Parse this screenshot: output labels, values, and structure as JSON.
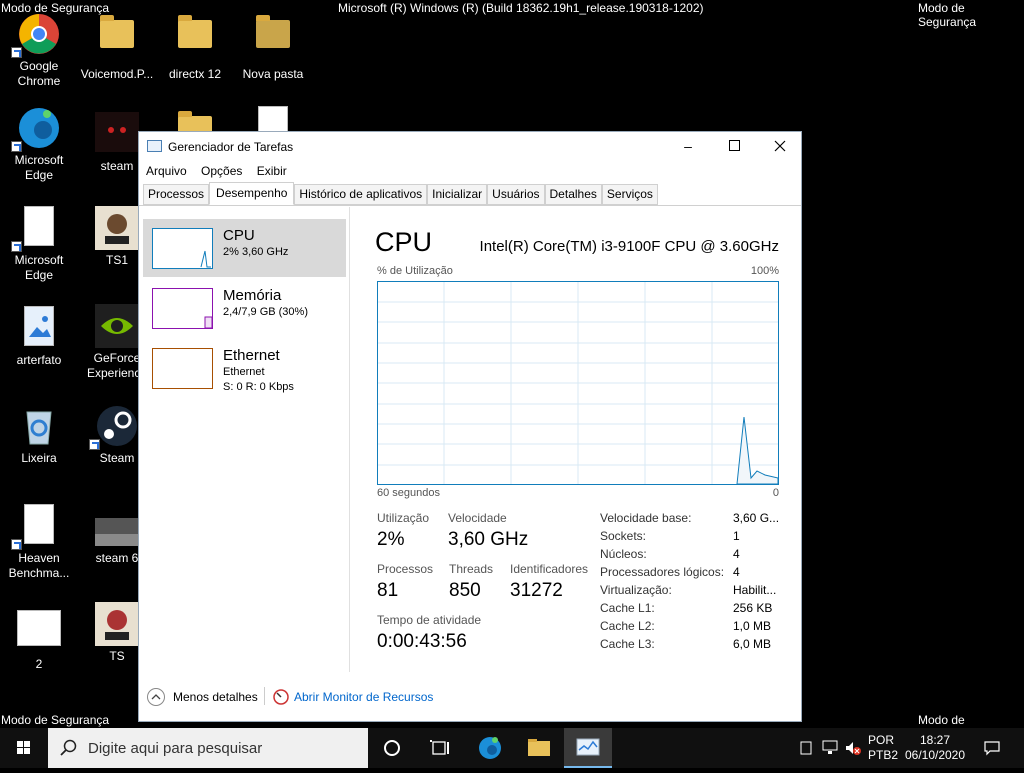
{
  "desktop": {
    "safe_mode": "Modo de Segurança",
    "build": "Microsoft (R) Windows (R) (Build 18362.19h1_release.190318-1202)",
    "icons": [
      {
        "label": "Google Chrome"
      },
      {
        "label": "Voicemod.P..."
      },
      {
        "label": "directx 12"
      },
      {
        "label": "Nova pasta"
      },
      {
        "label": "Microsoft Edge"
      },
      {
        "label": "steam"
      },
      {
        "label": "Microsoft Edge"
      },
      {
        "label": "TS1"
      },
      {
        "label": "arterfato"
      },
      {
        "label": "GeForce Experience"
      },
      {
        "label": "Lixeira"
      },
      {
        "label": "Steam"
      },
      {
        "label": "Heaven Benchma..."
      },
      {
        "label": "steam 6"
      },
      {
        "label": "2"
      },
      {
        "label": "TS"
      }
    ]
  },
  "window": {
    "title": "Gerenciador de Tarefas",
    "menu": [
      "Arquivo",
      "Opções",
      "Exibir"
    ],
    "tabs": [
      "Processos",
      "Desempenho",
      "Histórico de aplicativos",
      "Inicializar",
      "Usuários",
      "Detalhes",
      "Serviços"
    ],
    "active_tab": "Desempenho"
  },
  "resources": [
    {
      "name": "CPU",
      "line2": "2% 3,60 GHz",
      "line3": "",
      "color": "#117dbb"
    },
    {
      "name": "Memória",
      "line2": "2,4/7,9 GB (30%)",
      "line3": "",
      "color": "#8b12ae"
    },
    {
      "name": "Ethernet",
      "line2": "Ethernet",
      "line3": "S: 0 R: 0 Kbps",
      "color": "#a74f01"
    }
  ],
  "cpu": {
    "title": "CPU",
    "model": "Intel(R) Core(TM) i3-9100F CPU @ 3.60GHz",
    "graph_label": "% de Utilização",
    "graph_max": "100%",
    "graph_time": "60 segundos",
    "graph_min": "0",
    "utilizacao_label": "Utilização",
    "utilizacao": "2%",
    "velocidade_label": "Velocidade",
    "velocidade": "3,60 GHz",
    "processos_label": "Processos",
    "processos": "81",
    "threads_label": "Threads",
    "threads": "850",
    "ident_label": "Identificadores",
    "ident": "31272",
    "tempo_label": "Tempo de atividade",
    "tempo": "0:00:43:56",
    "details": [
      {
        "k": "Velocidade base:",
        "v": "3,60 G..."
      },
      {
        "k": "Sockets:",
        "v": "1"
      },
      {
        "k": "Núcleos:",
        "v": "4"
      },
      {
        "k": "Processadores lógicos:",
        "v": "4"
      },
      {
        "k": "Virtualização:",
        "v": "Habilit..."
      },
      {
        "k": "Cache L1:",
        "v": "256 KB"
      },
      {
        "k": "Cache L2:",
        "v": "1,0 MB"
      },
      {
        "k": "Cache L3:",
        "v": "6,0 MB"
      }
    ]
  },
  "footer": {
    "less": "Menos detalhes",
    "monitor": "Abrir Monitor de Recursos"
  },
  "taskbar": {
    "search_placeholder": "Digite aqui para pesquisar",
    "lang1": "POR",
    "lang2": "PTB2",
    "time": "18:27",
    "date": "06/10/2020"
  }
}
